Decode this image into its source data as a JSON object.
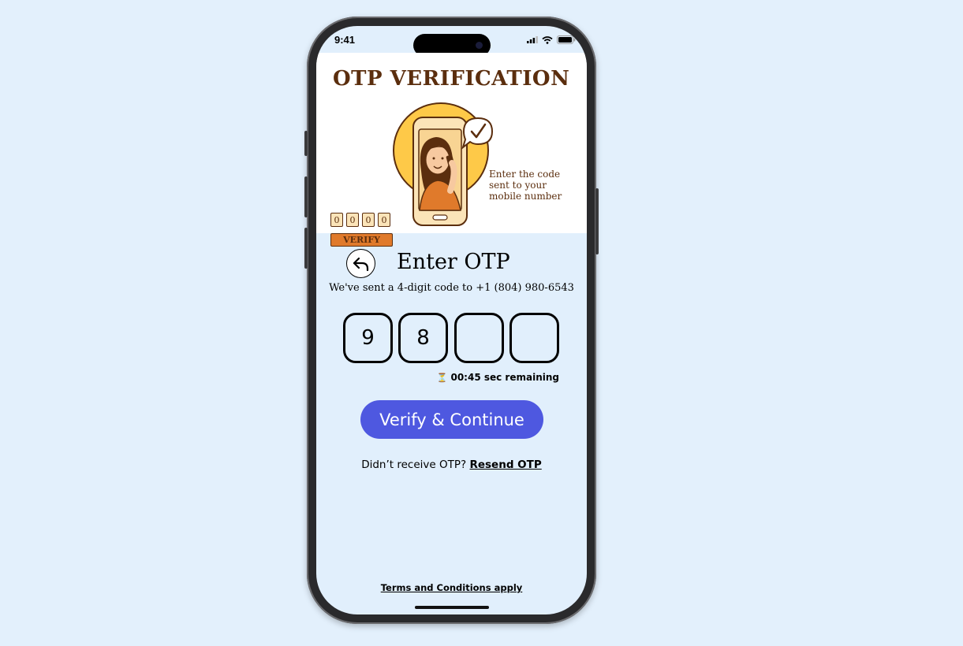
{
  "status_bar": {
    "time": "9:41"
  },
  "hero": {
    "title": "OTP VERIFICATION",
    "caption_lines": [
      "Enter the code",
      "sent to your",
      "mobile number"
    ],
    "mini_digits": [
      "0",
      "0",
      "0",
      "0"
    ],
    "mini_verify_label": "VERIFY"
  },
  "header": {
    "title": "Enter OTP",
    "subtitle": "We've sent a 4-digit code to +1 (804) 980-6543"
  },
  "otp": {
    "digits": [
      "9",
      "8",
      "",
      ""
    ],
    "timer_icon": "⏳",
    "timer_text": "00:45 sec remaining"
  },
  "actions": {
    "verify_label": "Verify & Continue",
    "resend_prompt": "Didn’t receive OTP? ",
    "resend_label": "Resend OTP"
  },
  "footer": {
    "terms_label": "Terms and Conditions apply"
  },
  "colors": {
    "page_background": "#e3f0fc",
    "screen_background": "#e1effc",
    "primary_button": "#4e58e0",
    "hero_text": "#5b2e0e",
    "hero_accent": "#e07a2b"
  }
}
